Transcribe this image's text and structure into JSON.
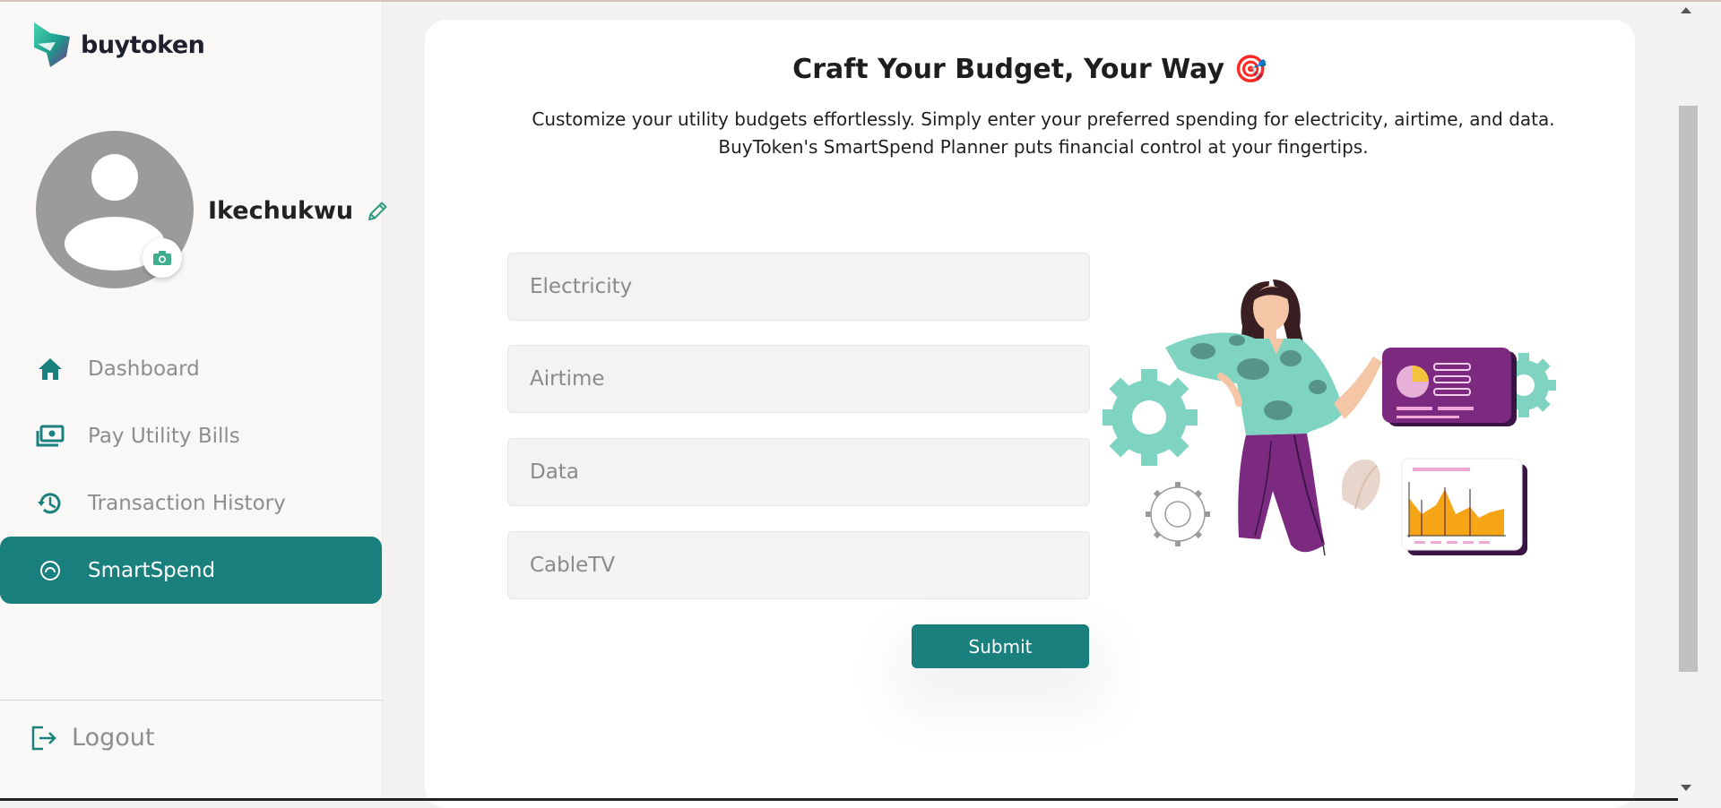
{
  "brand": {
    "name": "buytoken"
  },
  "profile": {
    "name": "Ikechukwu"
  },
  "nav": {
    "items": [
      {
        "label": "Dashboard",
        "icon": "home-icon"
      },
      {
        "label": "Pay Utility Bills",
        "icon": "money-icon"
      },
      {
        "label": "Transaction History",
        "icon": "history-icon"
      },
      {
        "label": "SmartSpend",
        "icon": "smartspend-icon",
        "active": true
      }
    ],
    "logout_label": "Logout"
  },
  "main": {
    "title": "Craft Your Budget, Your Way 🎯",
    "subtitle": "Customize your utility budgets effortlessly. Simply enter your preferred spending for electricity, airtime, and data. BuyToken's SmartSpend Planner puts financial control at your fingertips.",
    "fields": {
      "electricity": {
        "placeholder": "Electricity",
        "value": ""
      },
      "airtime": {
        "placeholder": "Airtime",
        "value": ""
      },
      "data": {
        "placeholder": "Data",
        "value": ""
      },
      "cabletv": {
        "placeholder": "CableTV",
        "value": ""
      }
    },
    "submit_label": "Submit"
  },
  "colors": {
    "accent": "#19807e",
    "illustration_mint": "#7fd3c1",
    "illustration_purple": "#7b2a80",
    "illustration_orange": "#f5a516"
  }
}
